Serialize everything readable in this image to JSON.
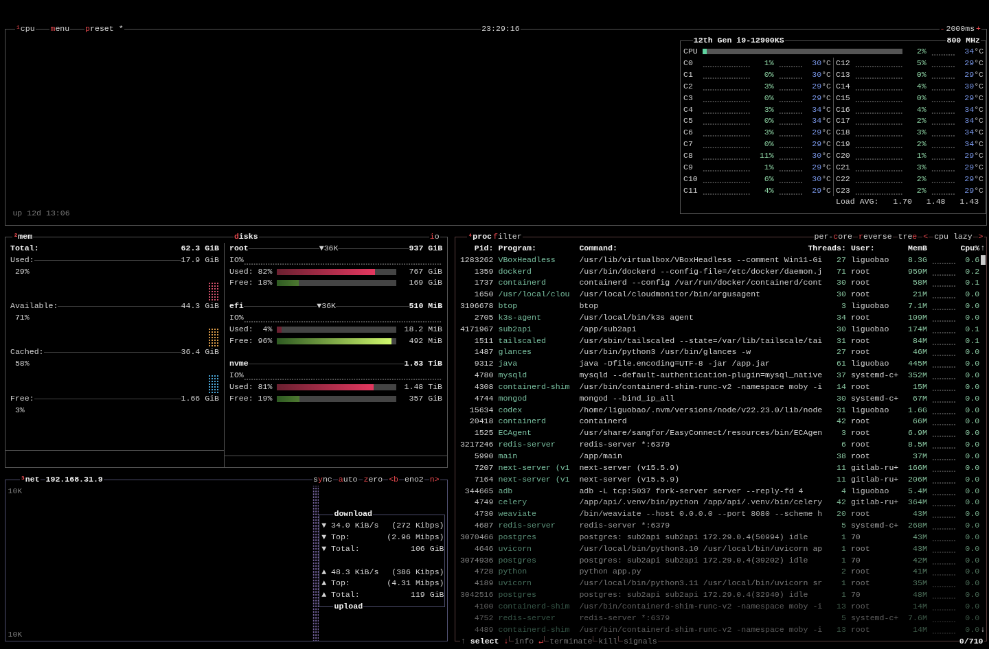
{
  "cpu": {
    "header": {
      "tabs": [
        {
          "key": "¹",
          "after": "cpu"
        },
        {
          "key": "m",
          "after": "enu"
        },
        {
          "key": "p",
          "after": "reset *"
        }
      ],
      "clock": "23:29:16",
      "interval": {
        "minus": "-",
        "value": "2000ms",
        "plus": "+"
      }
    },
    "uptime": "up 12d 13:06",
    "model": "12th Gen i9-12900KS",
    "frequency": "800 MHz",
    "total": {
      "name": "CPU",
      "level": 0.02,
      "percent": "2%",
      "temp": "34",
      "unit": "°C"
    },
    "cores": [
      {
        "name": "C0",
        "percent": "1%",
        "temp": "30",
        "unit": "°C"
      },
      {
        "name": "C1",
        "percent": "0%",
        "temp": "30",
        "unit": "°C"
      },
      {
        "name": "C2",
        "percent": "3%",
        "temp": "29",
        "unit": "°C"
      },
      {
        "name": "C3",
        "percent": "0%",
        "temp": "29",
        "unit": "°C"
      },
      {
        "name": "C4",
        "percent": "3%",
        "temp": "34",
        "unit": "°C"
      },
      {
        "name": "C5",
        "percent": "0%",
        "temp": "34",
        "unit": "°C"
      },
      {
        "name": "C6",
        "percent": "3%",
        "temp": "29",
        "unit": "°C"
      },
      {
        "name": "C7",
        "percent": "0%",
        "temp": "29",
        "unit": "°C"
      },
      {
        "name": "C8",
        "percent": "11%",
        "temp": "30",
        "unit": "°C"
      },
      {
        "name": "C9",
        "percent": "1%",
        "temp": "29",
        "unit": "°C"
      },
      {
        "name": "C10",
        "percent": "6%",
        "temp": "30",
        "unit": "°C"
      },
      {
        "name": "C11",
        "percent": "4%",
        "temp": "29",
        "unit": "°C"
      },
      {
        "name": "C12",
        "percent": "5%",
        "temp": "29",
        "unit": "°C"
      },
      {
        "name": "C13",
        "percent": "0%",
        "temp": "29",
        "unit": "°C"
      },
      {
        "name": "C14",
        "percent": "4%",
        "temp": "30",
        "unit": "°C"
      },
      {
        "name": "C15",
        "percent": "0%",
        "temp": "29",
        "unit": "°C"
      },
      {
        "name": "C16",
        "percent": "4%",
        "temp": "34",
        "unit": "°C"
      },
      {
        "name": "C17",
        "percent": "2%",
        "temp": "34",
        "unit": "°C"
      },
      {
        "name": "C18",
        "percent": "3%",
        "temp": "34",
        "unit": "°C"
      },
      {
        "name": "C19",
        "percent": "2%",
        "temp": "34",
        "unit": "°C"
      },
      {
        "name": "C20",
        "percent": "1%",
        "temp": "29",
        "unit": "°C"
      },
      {
        "name": "C21",
        "percent": "3%",
        "temp": "29",
        "unit": "°C"
      },
      {
        "name": "C22",
        "percent": "2%",
        "temp": "29",
        "unit": "°C"
      },
      {
        "name": "C23",
        "percent": "2%",
        "temp": "29",
        "unit": "°C"
      }
    ],
    "load_avg": {
      "label": "Load AVG:",
      "values": [
        "1.70",
        "1.48",
        "1.43"
      ]
    }
  },
  "mem": {
    "title": {
      "key": "²",
      "after": "mem"
    },
    "items": [
      {
        "kind": "total",
        "label": "Total:",
        "value": "62.3 GiB"
      },
      {
        "kind": "meter",
        "label": "Used:",
        "value": "17.9 GiB",
        "percent": "29%",
        "color": "#d0506a"
      },
      {
        "kind": "meter",
        "label": "Available:",
        "value": "44.3 GiB",
        "percent": "71%",
        "color": "#d99a48"
      },
      {
        "kind": "meter",
        "label": "Cached:",
        "value": "36.4 GiB",
        "percent": "58%",
        "color": "#4aa6d8"
      },
      {
        "kind": "meter",
        "label": "Free:",
        "value": "1.66 GiB",
        "percent": "3%"
      }
    ]
  },
  "disks": {
    "title": {
      "key": "d",
      "after": "isks"
    },
    "io_tab": {
      "key": "i",
      "after": "o"
    },
    "items": [
      {
        "name": "root",
        "io": "▼36K",
        "size": "937 GiB",
        "io_label": "IO%",
        "used": {
          "label": "Used:",
          "percent": "82%",
          "level": 0.82,
          "value": "767 GiB"
        },
        "free": {
          "label": "Free:",
          "percent": "18%",
          "level": 0.18,
          "value": "169 GiB"
        }
      },
      {
        "name": "efi",
        "io": "▼36K",
        "size": "510 MiB",
        "io_label": "IO%",
        "used": {
          "label": "Used:",
          "percent": "4%",
          "level": 0.04,
          "value": "18.2 MiB"
        },
        "free": {
          "label": "Free:",
          "percent": "96%",
          "level": 0.96,
          "value": "492 MiB"
        }
      },
      {
        "name": "nvme",
        "size": "1.83 TiB",
        "io_label": "IO%",
        "used": {
          "label": "Used:",
          "percent": "81%",
          "level": 0.81,
          "value": "1.48 TiB"
        },
        "free": {
          "label": "Free:",
          "percent": "19%",
          "level": 0.19,
          "value": "357 GiB"
        }
      }
    ]
  },
  "net": {
    "title": {
      "key": "³",
      "after": "net"
    },
    "address": "192.168.31.9",
    "tabs": [
      {
        "before": "s",
        "key": "y",
        "after": "nc"
      },
      {
        "key": "a",
        "after": "uto"
      },
      {
        "key": "z",
        "after": "ero"
      },
      {
        "key": "<b"
      },
      {
        "before": "eno2"
      },
      {
        "key": "n>"
      }
    ],
    "scale_top": "10K",
    "scale_bottom": "10K",
    "download": {
      "title": "download",
      "rows": [
        {
          "arrow": "▼",
          "label": "34.0 KiB/s",
          "value": "(272 Kibps)"
        },
        {
          "arrow": "▼",
          "label": "Top:",
          "value": "(2.96 Mibps)"
        },
        {
          "arrow": "▼",
          "label": "Total:",
          "value": "106 GiB"
        }
      ]
    },
    "upload": {
      "title": "upload",
      "rows": [
        {
          "arrow": "▲",
          "label": "48.3 KiB/s",
          "value": "(386 Kibps)"
        },
        {
          "arrow": "▲",
          "label": "Top:",
          "value": "(4.31 Mibps)"
        },
        {
          "arrow": "▲",
          "label": "Total:",
          "value": "119 GiB"
        }
      ]
    }
  },
  "proc": {
    "title": {
      "key": "⁴",
      "after": "proc"
    },
    "filter": {
      "key": "f",
      "after": "ilter"
    },
    "options": [
      {
        "before": "per-",
        "key": "c",
        "after": "ore"
      },
      {
        "key": "r",
        "after": "everse"
      },
      {
        "before": "tre",
        "key": "e"
      },
      {
        "key": "<"
      },
      {
        "before": "cpu lazy"
      },
      {
        "key": ">"
      }
    ],
    "columns": [
      "Pid:",
      "Program:",
      "Command:",
      "Threads:",
      "User:",
      "MemB",
      "Cpu%"
    ],
    "scroll": {
      "up": "↑",
      "down": "↓"
    },
    "rows": [
      {
        "pid": "1283262",
        "program": "VBoxHeadless",
        "command": "/usr/lib/virtualbox/VBoxHeadless --comment Win11-Gi",
        "threads": "27",
        "user": "liguobao",
        "mem": "8.3G",
        "cpu": "0.6"
      },
      {
        "pid": "1359",
        "program": "dockerd",
        "command": "/usr/bin/dockerd --config-file=/etc/docker/daemon.j",
        "threads": "71",
        "user": "root",
        "mem": "959M",
        "cpu": "0.2"
      },
      {
        "pid": "1737",
        "program": "containerd",
        "command": "containerd --config /var/run/docker/containerd/cont",
        "threads": "30",
        "user": "root",
        "mem": "58M",
        "cpu": "0.1"
      },
      {
        "pid": "1650",
        "program": "/usr/local/clou",
        "command": "/usr/local/cloudmonitor/bin/argusagent",
        "threads": "30",
        "user": "root",
        "mem": "21M",
        "cpu": "0.0"
      },
      {
        "pid": "3106678",
        "program": "btop",
        "command": "btop",
        "threads": "3",
        "user": "liguobao",
        "mem": "7.1M",
        "cpu": "0.0"
      },
      {
        "pid": "2705",
        "program": "k3s-agent",
        "command": "/usr/local/bin/k3s agent",
        "threads": "34",
        "user": "root",
        "mem": "109M",
        "cpu": "0.0"
      },
      {
        "pid": "4171967",
        "program": "sub2api",
        "command": "/app/sub2api",
        "threads": "30",
        "user": "liguobao",
        "mem": "174M",
        "cpu": "0.1"
      },
      {
        "pid": "1511",
        "program": "tailscaled",
        "command": "/usr/sbin/tailscaled --state=/var/lib/tailscale/tai",
        "threads": "31",
        "user": "root",
        "mem": "84M",
        "cpu": "0.1"
      },
      {
        "pid": "1487",
        "program": "glances",
        "command": "/usr/bin/python3 /usr/bin/glances -w",
        "threads": "27",
        "user": "root",
        "mem": "46M",
        "cpu": "0.0"
      },
      {
        "pid": "9312",
        "program": "java",
        "command": "java -Dfile.encoding=UTF-8 -jar /app.jar",
        "threads": "61",
        "user": "liguobao",
        "mem": "445M",
        "cpu": "0.0"
      },
      {
        "pid": "4780",
        "program": "mysqld",
        "command": "mysqld --default-authentication-plugin=mysql_native",
        "threads": "37",
        "user": "systemd-c+",
        "mem": "352M",
        "cpu": "0.0"
      },
      {
        "pid": "4308",
        "program": "containerd-shim",
        "command": "/usr/bin/containerd-shim-runc-v2 -namespace moby -i",
        "threads": "14",
        "user": "root",
        "mem": "15M",
        "cpu": "0.0"
      },
      {
        "pid": "4744",
        "program": "mongod",
        "command": "mongod --bind_ip_all",
        "threads": "30",
        "user": "systemd-c+",
        "mem": "67M",
        "cpu": "0.0"
      },
      {
        "pid": "15634",
        "program": "codex",
        "command": "/home/liguobao/.nvm/versions/node/v22.23.0/lib/node",
        "threads": "31",
        "user": "liguobao",
        "mem": "1.6G",
        "cpu": "0.0"
      },
      {
        "pid": "20418",
        "program": "containerd",
        "command": "containerd",
        "threads": "42",
        "user": "root",
        "mem": "66M",
        "cpu": "0.0"
      },
      {
        "pid": "1525",
        "program": "ECAgent",
        "command": "/usr/share/sangfor/EasyConnect/resources/bin/ECAgen",
        "threads": "3",
        "user": "root",
        "mem": "6.9M",
        "cpu": "0.0"
      },
      {
        "pid": "3217246",
        "program": "redis-server",
        "command": "redis-server *:6379",
        "threads": "6",
        "user": "root",
        "mem": "8.5M",
        "cpu": "0.0"
      },
      {
        "pid": "5990",
        "program": "main",
        "command": "/app/main",
        "threads": "38",
        "user": "root",
        "mem": "37M",
        "cpu": "0.0"
      },
      {
        "pid": "7207",
        "program": "next-server (v1",
        "command": "next-server (v15.5.9)",
        "threads": "11",
        "user": "gitlab-ru+",
        "mem": "166M",
        "cpu": "0.0"
      },
      {
        "pid": "7164",
        "program": "next-server (v1",
        "command": "next-server (v15.5.9)",
        "threads": "11",
        "user": "gitlab-ru+",
        "mem": "206M",
        "cpu": "0.0"
      },
      {
        "pid": "344665",
        "program": "adb",
        "command": "adb -L tcp:5037 fork-server server --reply-fd 4",
        "threads": "4",
        "user": "liguobao",
        "mem": "5.4M",
        "cpu": "0.0"
      },
      {
        "pid": "4749",
        "program": "celery",
        "command": "/app/api/.venv/bin/python /app/api/.venv/bin/celery",
        "threads": "42",
        "user": "gitlab-ru+",
        "mem": "364M",
        "cpu": "0.0"
      },
      {
        "pid": "4730",
        "program": "weaviate",
        "command": "/bin/weaviate --host 0.0.0.0 --port 8080 --scheme h",
        "threads": "20",
        "user": "root",
        "mem": "43M",
        "cpu": "0.0"
      },
      {
        "pid": "4687",
        "program": "redis-server",
        "command": "redis-server *:6379",
        "threads": "5",
        "user": "systemd-c+",
        "mem": "268M",
        "cpu": "0.0"
      },
      {
        "pid": "3070466",
        "program": "postgres",
        "command": "postgres: sub2api sub2api 172.29.0.4(50994) idle",
        "threads": "1",
        "user": "70",
        "mem": "43M",
        "cpu": "0.0"
      },
      {
        "pid": "4646",
        "program": "uvicorn",
        "command": "/usr/local/bin/python3.10 /usr/local/bin/uvicorn ap",
        "threads": "1",
        "user": "root",
        "mem": "43M",
        "cpu": "0.0"
      },
      {
        "pid": "3074936",
        "program": "postgres",
        "command": "postgres: sub2api sub2api 172.29.0.4(39202) idle",
        "threads": "1",
        "user": "70",
        "mem": "42M",
        "cpu": "0.0"
      },
      {
        "pid": "4728",
        "program": "python",
        "command": "python app.py",
        "threads": "2",
        "user": "root",
        "mem": "41M",
        "cpu": "0.0"
      },
      {
        "pid": "4189",
        "program": "uvicorn",
        "command": "/usr/local/bin/python3.11 /usr/local/bin/uvicorn sr",
        "threads": "1",
        "user": "root",
        "mem": "35M",
        "cpu": "0.0"
      },
      {
        "pid": "3042516",
        "program": "postgres",
        "command": "postgres: sub2api sub2api 172.29.0.4(32940) idle",
        "threads": "1",
        "user": "70",
        "mem": "48M",
        "cpu": "0.0"
      },
      {
        "pid": "4100",
        "program": "containerd-shim",
        "command": "/usr/bin/containerd-shim-runc-v2 -namespace moby -i",
        "threads": "13",
        "user": "root",
        "mem": "14M",
        "cpu": "0.0"
      },
      {
        "pid": "4752",
        "program": "redis-server",
        "command": "redis-server *:6379",
        "threads": "5",
        "user": "systemd-c+",
        "mem": "7.6M",
        "cpu": "0.0"
      },
      {
        "pid": "4489",
        "program": "containerd-shim",
        "command": "/usr/bin/containerd-shim-runc-v2 -namespace moby -i",
        "threads": "13",
        "user": "root",
        "mem": "14M",
        "cpu": "0.0"
      }
    ],
    "footer": [
      {
        "before": "↑",
        "label": "select",
        "after": "↓",
        "disabled": false
      },
      {
        "label": "info",
        "after": "↵",
        "disabled": true
      },
      {
        "label": "terminate",
        "disabled": true
      },
      {
        "label": "kill",
        "disabled": true
      },
      {
        "label": "signals",
        "disabled": true
      }
    ],
    "count": "0/710"
  }
}
